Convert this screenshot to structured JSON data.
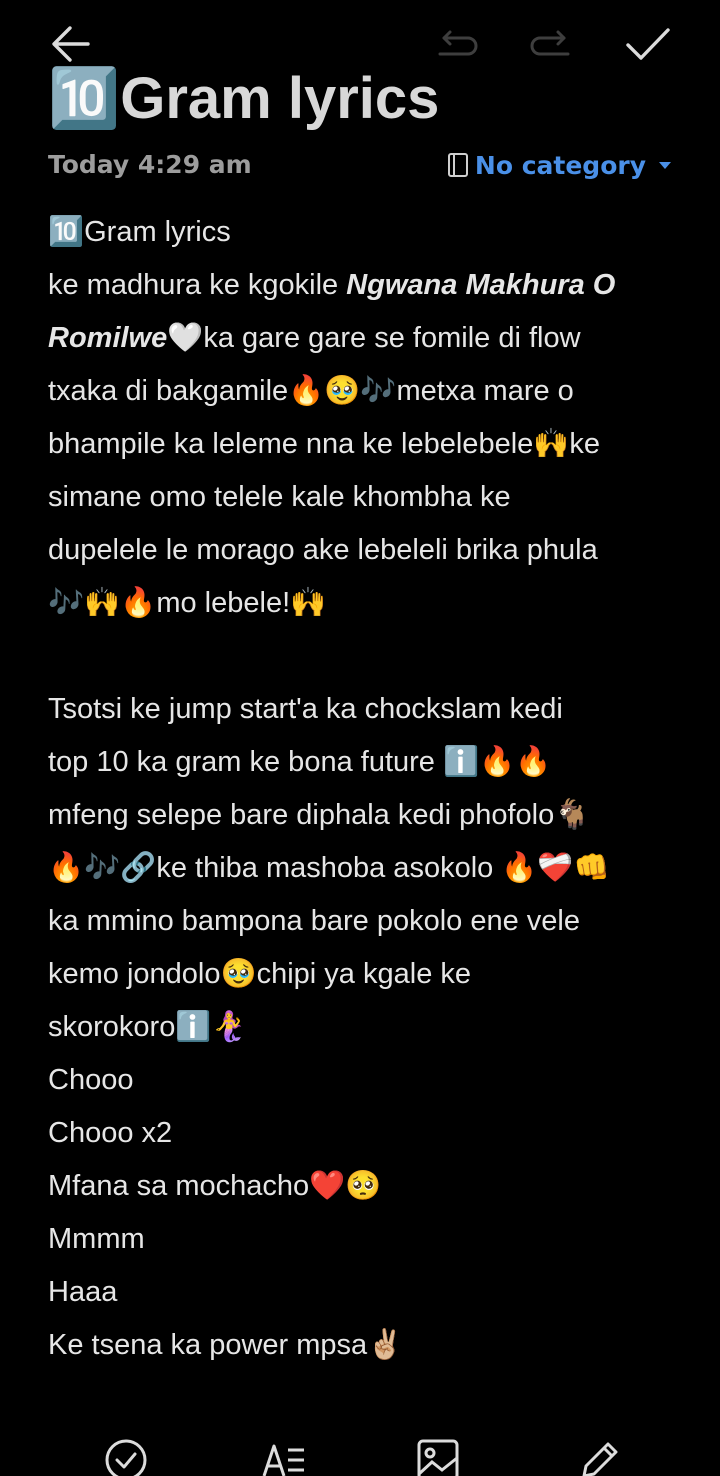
{
  "toolbar": {
    "back_icon": "arrow-left-icon",
    "undo_icon": "undo-icon",
    "redo_icon": "redo-icon",
    "done_icon": "check-icon"
  },
  "note": {
    "title": "🔟Gram lyrics",
    "date": "Today 4:29 am",
    "category": "No category",
    "category_icon": "notebook-icon",
    "body": [
      {
        "text": "🔟Gram lyrics"
      },
      {
        "parts": [
          {
            "t": "ke madhura ke kgokile "
          },
          {
            "t": "Ngwana Makhura O",
            "em": true
          }
        ]
      },
      {
        "parts": [
          {
            "t": "Romilwe",
            "em": true
          },
          {
            "t": "🤍ka gare gare se fomile di flow"
          }
        ]
      },
      {
        "text": "txaka di bakgamile🔥🥹🎶metxa mare o"
      },
      {
        "text": "bhampile ka leleme nna ke lebelebele🙌ke"
      },
      {
        "text": "simane omo telele kale khombha ke"
      },
      {
        "text": "dupelele le morago ake lebeleli brika phula"
      },
      {
        "text": "🎶🙌🔥mo lebele!🙌"
      },
      {
        "text": ""
      },
      {
        "text": "Tsotsi ke jump start'a ka chockslam kedi"
      },
      {
        "text": "top 10 ka gram ke bona future ℹ️🔥🔥"
      },
      {
        "text": "mfeng selepe bare diphala kedi phofolo🐐"
      },
      {
        "text": "🔥🎶🔗ke thiba mashoba asokolo 🔥❤️‍🩹👊"
      },
      {
        "text": "ka mmino bampona bare pokolo ene vele"
      },
      {
        "text": "kemo jondolo🥹chipi ya kgale ke"
      },
      {
        "text": "skorokoroℹ️🧜‍♀️"
      },
      {
        "text": "  Chooo"
      },
      {
        "text": "  Chooo x2"
      },
      {
        "text": "Mfana sa mochacho❤️🥺"
      },
      {
        "text": "Mmmm"
      },
      {
        "text": "Haaa"
      },
      {
        "text": "Ke tsena ka power mpsa✌🏼"
      }
    ]
  },
  "bottom_bar": {
    "checklist_icon": "checkbox-circle-icon",
    "text_style_icon": "text-format-icon",
    "image_icon": "image-icon",
    "draw_icon": "pencil-icon"
  },
  "colors": {
    "background": "#000000",
    "text": "#e6e6e6",
    "meta_text": "#9d9d9d",
    "accent": "#4a90e8"
  }
}
